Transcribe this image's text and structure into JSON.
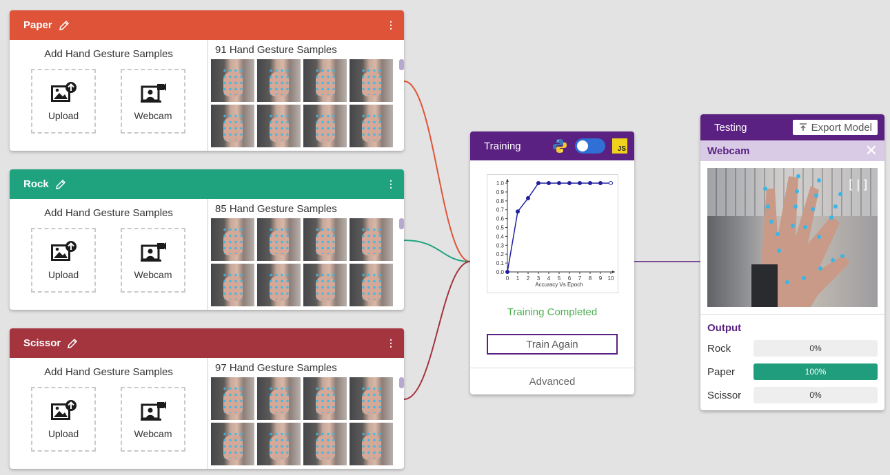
{
  "classes": [
    {
      "name": "Paper",
      "color": "#df5438",
      "add_title": "Add Hand Gesture Samples",
      "upload_label": "Upload",
      "webcam_label": "Webcam",
      "samples_title": "91 Hand Gesture Samples",
      "wire_color": "#df5438"
    },
    {
      "name": "Rock",
      "color": "#1fa37f",
      "add_title": "Add Hand Gesture Samples",
      "upload_label": "Upload",
      "webcam_label": "Webcam",
      "samples_title": "85 Hand Gesture Samples",
      "wire_color": "#1fa37f"
    },
    {
      "name": "Scissor",
      "color": "#a4343e",
      "add_title": "Add Hand Gesture Samples",
      "upload_label": "Upload",
      "webcam_label": "Webcam",
      "samples_title": "97 Hand Gesture Samples",
      "wire_color": "#a4343e"
    }
  ],
  "icons": {
    "edit": "pencil-icon",
    "menu": "kebab-menu-icon",
    "upload": "image-upload-icon",
    "webcam": "webcam-icon",
    "python": "python-icon",
    "js": "javascript-icon",
    "export": "export-icon",
    "close": "close-icon",
    "mirror": "mirror-icon"
  },
  "training": {
    "title": "Training",
    "js_badge": "JS",
    "status": "Training Completed",
    "status_color": "#4caf50",
    "train_again_label": "Train Again",
    "advanced_label": "Advanced",
    "accent": "#5a2182",
    "chart_data": {
      "type": "line",
      "x": [
        0,
        1,
        2,
        3,
        4,
        5,
        6,
        7,
        8,
        9,
        10
      ],
      "series": [
        {
          "values": [
            0.0,
            0.68,
            0.83,
            1.0,
            1.0,
            1.0,
            1.0,
            1.0,
            1.0,
            1.0,
            1.0
          ]
        }
      ],
      "xlabel": "Accuracy Vs Epoch",
      "ylabel": "",
      "xlim": [
        0,
        10
      ],
      "ylim": [
        0.0,
        1.0
      ],
      "xticks": [
        "0",
        "1",
        "2",
        "3",
        "4",
        "5",
        "6",
        "7",
        "8",
        "9",
        "10"
      ],
      "yticks": [
        "0.0",
        "0.1",
        "0.2",
        "0.3",
        "0.4",
        "0.5",
        "0.6",
        "0.7",
        "0.8",
        "0.9",
        "1.0"
      ],
      "line_color": "#1f1f9e",
      "grid": false
    }
  },
  "testing": {
    "title": "Testing",
    "export_label": "Export Model",
    "webcam_title": "Webcam",
    "output_title": "Output",
    "outputs": [
      {
        "label": "Rock",
        "percent": 0,
        "text": "0%"
      },
      {
        "label": "Paper",
        "percent": 100,
        "text": "100%"
      },
      {
        "label": "Scissor",
        "percent": 0,
        "text": "0%"
      }
    ]
  }
}
